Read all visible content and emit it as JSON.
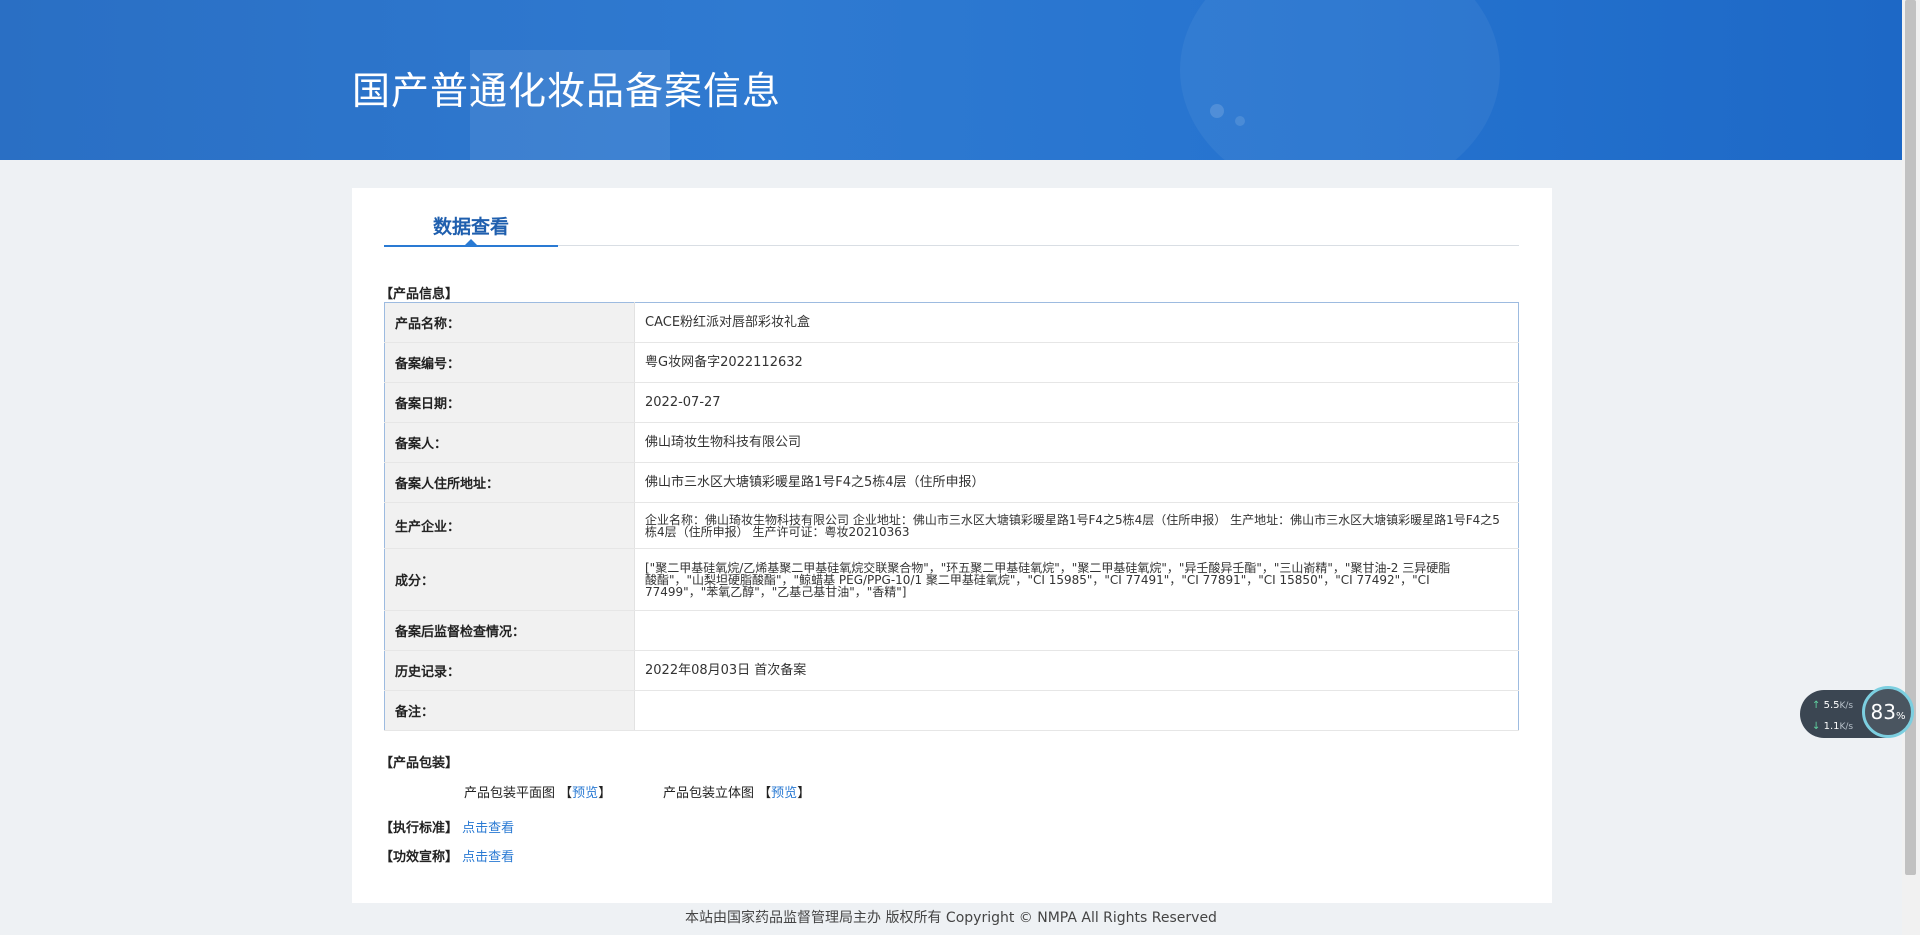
{
  "banner": {
    "title": "国产普通化妆品备案信息"
  },
  "tabs": [
    {
      "label": "数据查看"
    }
  ],
  "product_info": {
    "section_title": "【产品信息】",
    "rows": [
      {
        "label": "产品名称：",
        "value": "CACE粉红派对唇部彩妆礼盒"
      },
      {
        "label": "备案编号：",
        "value": "粤G妆网备字2022112632"
      },
      {
        "label": "备案日期：",
        "value": "2022-07-27"
      },
      {
        "label": "备案人：",
        "value": "佛山琦妆生物科技有限公司"
      },
      {
        "label": "备案人住所地址：",
        "value": "佛山市三水区大塘镇彩暖星路1号F4之5栋4层（住所申报）"
      },
      {
        "label": "生产企业：",
        "value": "企业名称：佛山琦妆生物科技有限公司 企业地址：佛山市三水区大塘镇彩暖星路1号F4之5栋4层（住所申报） 生产地址：佛山市三水区大塘镇彩暖星路1号F4之5栋4层（住所申报） 生产许可证：粤妆20210363"
      },
      {
        "label": "成分：",
        "value": "[\"聚二甲基硅氧烷/乙烯基聚二甲基硅氧烷交联聚合物\"，\"环五聚二甲基硅氧烷\"，\"聚二甲基硅氧烷\"，\"异壬酸异壬酯\"，\"三山嵛精\"，\"聚甘油-2 三异硬脂酸酯\"，\"山梨坦硬脂酸酯\"，\"鲸蜡基 PEG/PPG-10/1 聚二甲基硅氧烷\"，\"CI 15985\"，\"CI 77491\"，\"CI 77891\"，\"CI 15850\"，\"CI 77492\"，\"CI 77499\"，\"苯氧乙醇\"，\"乙基己基甘油\"，\"香精\"]"
      },
      {
        "label": "备案后监督检查情况：",
        "value": ""
      },
      {
        "label": "历史记录：",
        "value": "2022年08月03日 首次备案"
      },
      {
        "label": "备注：",
        "value": ""
      }
    ]
  },
  "packaging": {
    "section_title": "【产品包装】",
    "flat_label": "产品包装平面图",
    "solid_label": "产品包装立体图",
    "bracket_open": "【",
    "bracket_close": "】",
    "preview_label": "预览"
  },
  "standard": {
    "section_title": "【执行标准】",
    "link": "点击查看"
  },
  "efficacy": {
    "section_title": "【功效宣称】",
    "link": "点击查看"
  },
  "footer": {
    "text": "本站由国家药品监督管理局主办 版权所有 Copyright © NMPA All Rights Reserved"
  },
  "net_widget": {
    "up_value": "5.5",
    "down_value": "1.1",
    "unit": "K/s",
    "percent": "83",
    "percent_sign": "%"
  }
}
